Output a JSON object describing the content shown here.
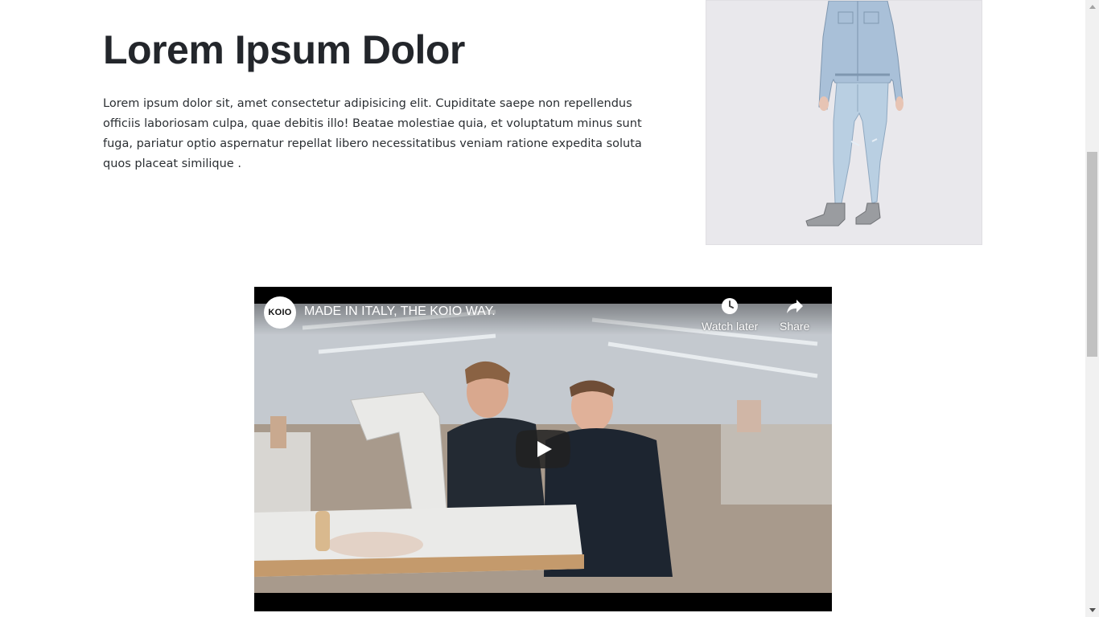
{
  "section": {
    "title": "Lorem Ipsum Dolor",
    "body": "Lorem ipsum dolor sit, amet consectetur adipisicing elit. Cupiditate saepe non repellendus officiis laboriosam culpa, quae debitis illo! Beatae molestiae quia, et voluptatum minus sunt fuga, pariatur optio aspernatur repellat libero necessitatibus veniam ratione expedita soluta quos placeat similique ."
  },
  "product_image": {
    "background_color": "#e9e8ec",
    "jacket_color": "#a9c0d8",
    "jeans_color": "#b9cfe2"
  },
  "video": {
    "channel_logo_text": "KOIO",
    "title": "MADE IN ITALY, THE KOIO WAY.",
    "watch_later_label": "Watch later",
    "share_label": "Share",
    "play_icon": "play-icon",
    "watch_later_icon": "clock-icon",
    "share_icon": "share-arrow-icon"
  },
  "scrollbar": {
    "position_fraction": 0.36
  }
}
